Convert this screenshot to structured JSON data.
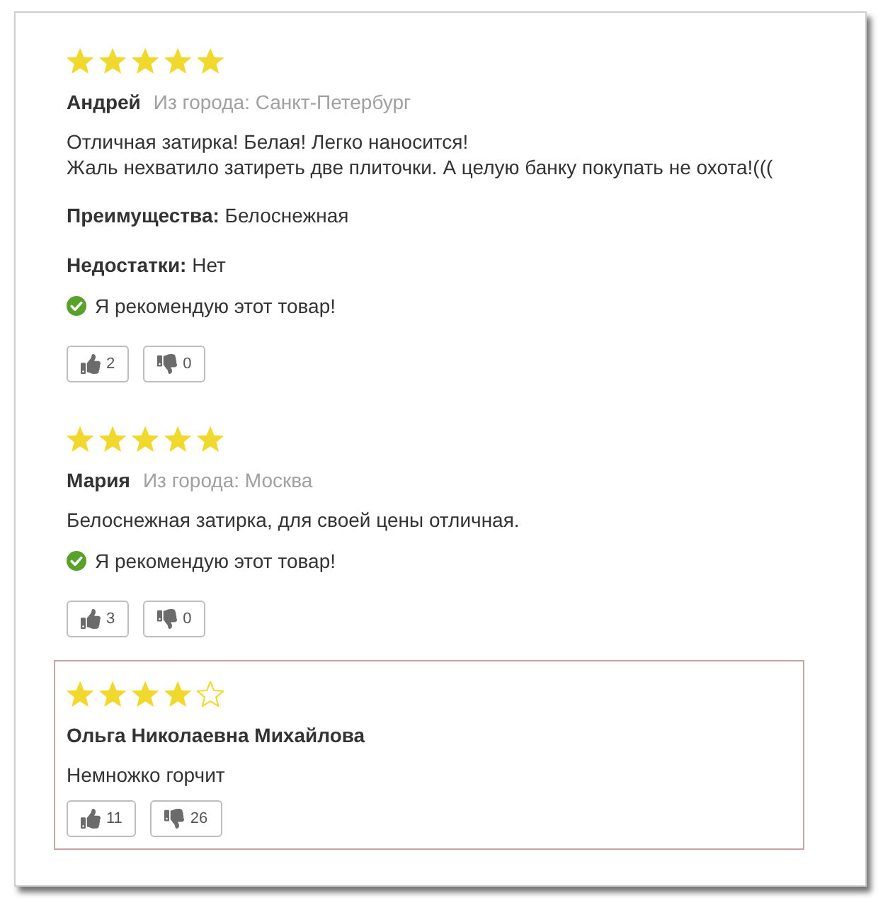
{
  "reviews": [
    {
      "stars": 5,
      "highlighted": false,
      "author": "Андрей",
      "city": "Из города: Санкт-Петербург",
      "text": "Отличная затирка! Белая! Легко наносится!\nЖаль нехватило затиреть две плиточки. А целую банку покупать не охота!(((",
      "pros": "**Преимущества:** Белоснежная",
      "cons": "**Недостатки:** Нет",
      "recommendation": "Я рекомендую этот товар!",
      "likes": "2",
      "dislikes": "0"
    },
    {
      "stars": 5,
      "highlighted": false,
      "author": "Мария",
      "city": "Из города: Москва",
      "text": "Белоснежная затирка, для своей цены отличная.",
      "recommendation": "Я рекомендую этот товар!",
      "likes": "3",
      "dislikes": "0"
    },
    {
      "stars": 4,
      "highlighted": true,
      "author": "Ольга Николаевна Михайлова",
      "text": "Немножко горчит",
      "likes": "11",
      "dislikes": "26"
    }
  ]
}
